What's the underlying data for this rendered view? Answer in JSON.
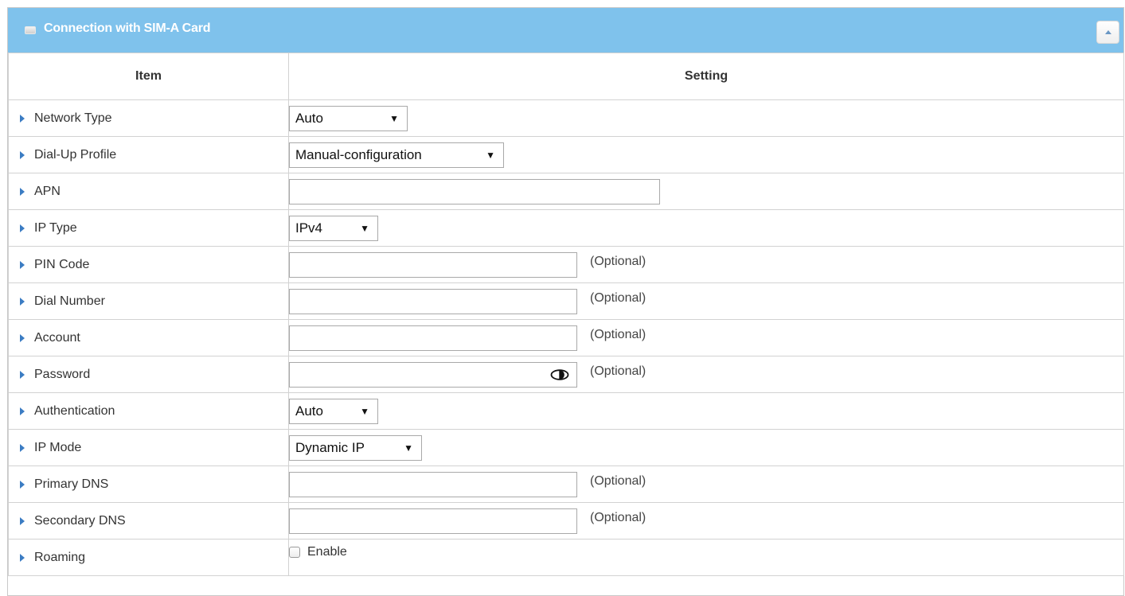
{
  "panel": {
    "title": "Connection with SIM-A Card",
    "header_color": "#7fc2ec"
  },
  "table": {
    "col_item": "Item",
    "col_setting": "Setting"
  },
  "rows": {
    "network_type": {
      "label": "Network Type",
      "value": "Auto"
    },
    "dial_up_profile": {
      "label": "Dial-Up Profile",
      "value": "Manual-configuration"
    },
    "apn": {
      "label": "APN",
      "value": ""
    },
    "ip_type": {
      "label": "IP Type",
      "value": "IPv4"
    },
    "pin_code": {
      "label": "PIN Code",
      "value": "",
      "hint": "(Optional)"
    },
    "dial_number": {
      "label": "Dial Number",
      "value": "",
      "hint": "(Optional)"
    },
    "account": {
      "label": "Account",
      "value": "",
      "hint": "(Optional)"
    },
    "password": {
      "label": "Password",
      "value": "",
      "hint": "(Optional)"
    },
    "authentication": {
      "label": "Authentication",
      "value": "Auto"
    },
    "ip_mode": {
      "label": "IP Mode",
      "value": "Dynamic IP"
    },
    "primary_dns": {
      "label": "Primary DNS",
      "value": "",
      "hint": "(Optional)"
    },
    "secondary_dns": {
      "label": "Secondary DNS",
      "value": "",
      "hint": "(Optional)"
    },
    "roaming": {
      "label": "Roaming",
      "checkbox_label": "Enable",
      "checked": false
    }
  },
  "caret": "▼"
}
